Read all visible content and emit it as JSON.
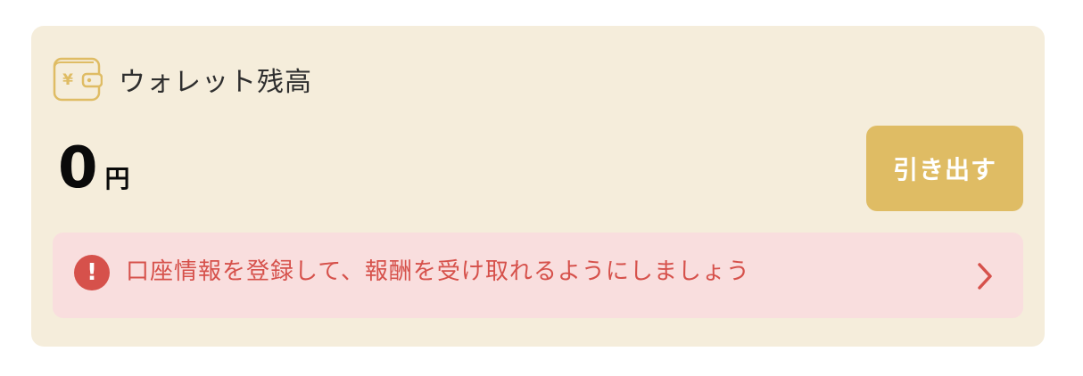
{
  "wallet": {
    "icon": "wallet-yen-icon",
    "icon_glyph": "¥",
    "title": "ウォレット残高",
    "balance_amount": "0",
    "balance_unit": "円",
    "withdraw_label": "引き出す"
  },
  "alert": {
    "icon": "exclamation-circle-icon",
    "icon_glyph": "!",
    "message": "口座情報を登録して、報酬を受け取れるようにしましょう",
    "chevron": "chevron-right-icon"
  },
  "colors": {
    "card_background": "#f5eddb",
    "accent_gold": "#dfbc64",
    "alert_background": "#f9dede",
    "alert_red": "#d6514b"
  }
}
